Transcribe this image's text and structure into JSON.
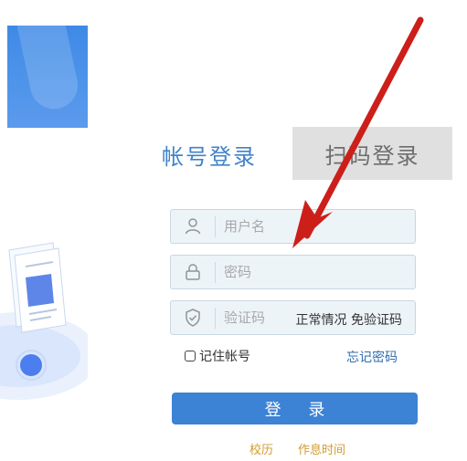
{
  "tabs": {
    "account_login": "帐号登录",
    "qr_login": "扫码登录"
  },
  "fields": {
    "username_placeholder": "用户名",
    "password_placeholder": "密码",
    "captcha_placeholder": "验证码",
    "captcha_hint": "正常情况 免验证码"
  },
  "options": {
    "remember_label": "记住帐号",
    "forgot_label": "忘记密码"
  },
  "login_button_label": "登 录",
  "footer": {
    "calendar_label": "校历",
    "schedule_label": "作息时间"
  },
  "colors": {
    "primary": "#3c82d5",
    "tab_active": "#3f83c9",
    "tab_inactive_bg": "#e0e0e0",
    "link": "#2f6fb0",
    "footer_link": "#d59a2f",
    "annotation_arrow": "#cc1f1a"
  },
  "icons": {
    "username": "user-icon",
    "password": "lock-icon",
    "captcha": "shield-check-icon",
    "remember": "checkbox-icon"
  }
}
